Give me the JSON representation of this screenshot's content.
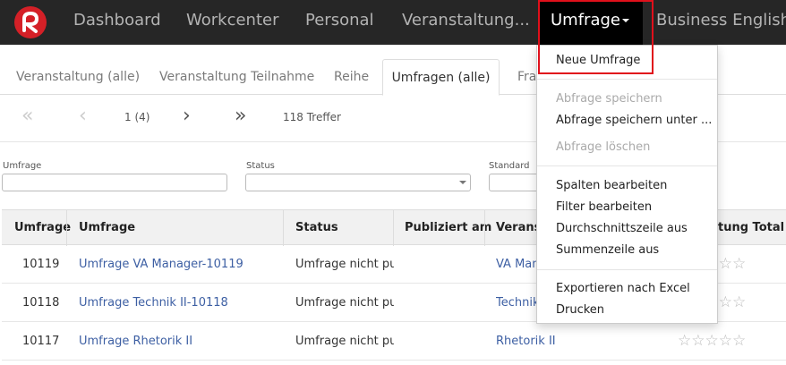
{
  "nav": {
    "items": [
      "Dashboard",
      "Workcenter",
      "Personal",
      "Veranstaltung..."
    ],
    "active": "Umfrage",
    "extra": "Business English"
  },
  "tabs": {
    "items": [
      "Veranstaltung (alle)",
      "Veranstaltung Teilnahme",
      "Reihe"
    ],
    "active": "Umfragen (alle)",
    "partial": "Frag"
  },
  "pager": {
    "page": "1 (4)",
    "hits": "118 Treffer"
  },
  "filters": {
    "umfrage_label": "Umfrage",
    "status_label": "Status",
    "standard_label": "Standard"
  },
  "table": {
    "headers": [
      "Umfrage",
      "Umfrage",
      "Status",
      "Publiziert am",
      "Veranst",
      "tung Total"
    ],
    "rows": [
      {
        "id": "10119",
        "name": "Umfrage VA Manager-10119",
        "status": "Umfrage nicht pul",
        "published": "",
        "event": "VA Man",
        "rating": 0
      },
      {
        "id": "10118",
        "name": "Umfrage Technik II-10118",
        "status": "Umfrage nicht pul",
        "published": "",
        "event": "Technik",
        "rating": 0
      },
      {
        "id": "10117",
        "name": "Umfrage Rhetorik II",
        "status": "Umfrage nicht pul",
        "published": "",
        "event": "Rhetorik II",
        "rating": 0
      }
    ]
  },
  "menu": {
    "new_survey": "Neue Umfrage",
    "save_query": "Abfrage speichern",
    "save_query_as": "Abfrage speichern unter ...",
    "delete_query": "Abfrage löschen",
    "edit_columns": "Spalten bearbeiten",
    "edit_filter": "Filter bearbeiten",
    "avg_row": "Durchschnittszeile aus",
    "sum_row": "Summenzeile aus",
    "export_excel": "Exportieren nach Excel",
    "print": "Drucken"
  },
  "colors": {
    "nav_bg": "#262626",
    "brand_red": "#d42027",
    "link_blue": "#3d5fa3",
    "highlight": "#e0101b"
  }
}
